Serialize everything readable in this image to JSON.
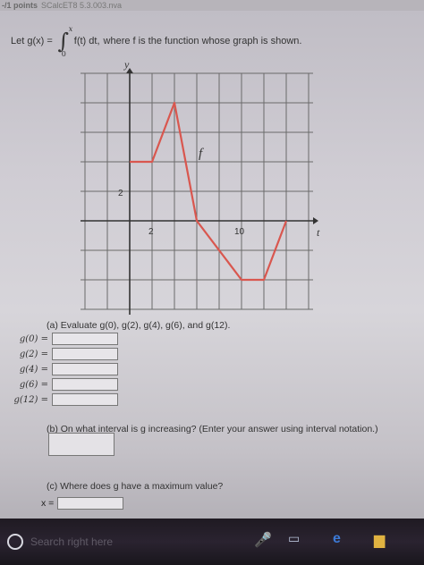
{
  "header": {
    "points": "-/1 points",
    "code": "SCalcET8 5.3.003.nva"
  },
  "question": {
    "prefix": "Let g(x) =",
    "integral_upper": "x",
    "integral_lower": "0",
    "integrand": "f(t) dt,",
    "suffix": "where f is the function whose graph is shown."
  },
  "graph": {
    "y_axis_label": "y",
    "x_axis_label": "t",
    "curve_label": "f",
    "y_tick_label": "2",
    "x_tick_labels": [
      "2",
      "10"
    ]
  },
  "part_a": {
    "prompt": "(a) Evaluate g(0), g(2), g(4), g(6), and g(12).",
    "rows": [
      {
        "label": "g(0) =",
        "value": ""
      },
      {
        "label": "g(2) =",
        "value": ""
      },
      {
        "label": "g(4) =",
        "value": ""
      },
      {
        "label": "g(6) =",
        "value": ""
      },
      {
        "label": "g(12) =",
        "value": ""
      }
    ]
  },
  "part_b": {
    "prompt": "(b) On what interval is g increasing? (Enter your answer using interval notation.)",
    "value": ""
  },
  "part_c": {
    "prompt": "(c) Where does g have a maximum value?",
    "x_label": "x =",
    "value": ""
  },
  "taskbar": {
    "search_placeholder": "Search right here"
  },
  "colors": {
    "curve": "#d9574f",
    "grid": "#6a6a6a",
    "taskbar": "#221c26"
  },
  "icons": [
    "cortana-circle-icon",
    "microphone-icon",
    "task-view-icon",
    "edge-browser-icon",
    "file-explorer-icon"
  ]
}
